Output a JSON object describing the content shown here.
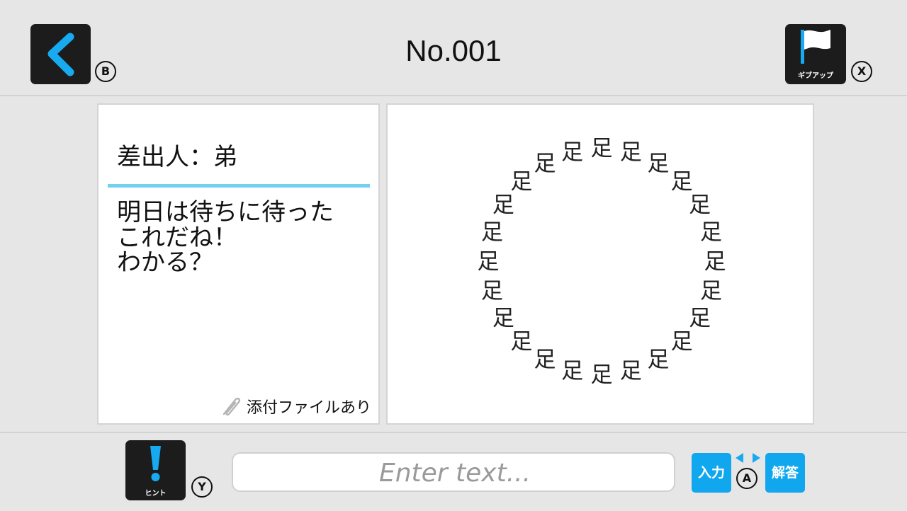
{
  "header": {
    "title": "No.001",
    "back_key": "B",
    "giveup_label": "ギブアップ",
    "giveup_key": "X"
  },
  "letter": {
    "sender": "差出人：弟",
    "message_lines": [
      "明日は待ちに待った",
      "これだね！",
      "わかる？"
    ],
    "attachment_label": "添付ファイルあり"
  },
  "puzzle": {
    "character": "足",
    "character_count": 24
  },
  "footer": {
    "hint_label": "ヒント",
    "hint_key": "Y",
    "input_placeholder": "Enter text...",
    "input_value": "",
    "input_button_label": "入力",
    "toggle_key": "A",
    "answer_button_label": "解答"
  },
  "colors": {
    "accent_blue": "#10a7ee",
    "rule_blue": "#74cff5",
    "tile_dark": "#1c1c1c"
  }
}
